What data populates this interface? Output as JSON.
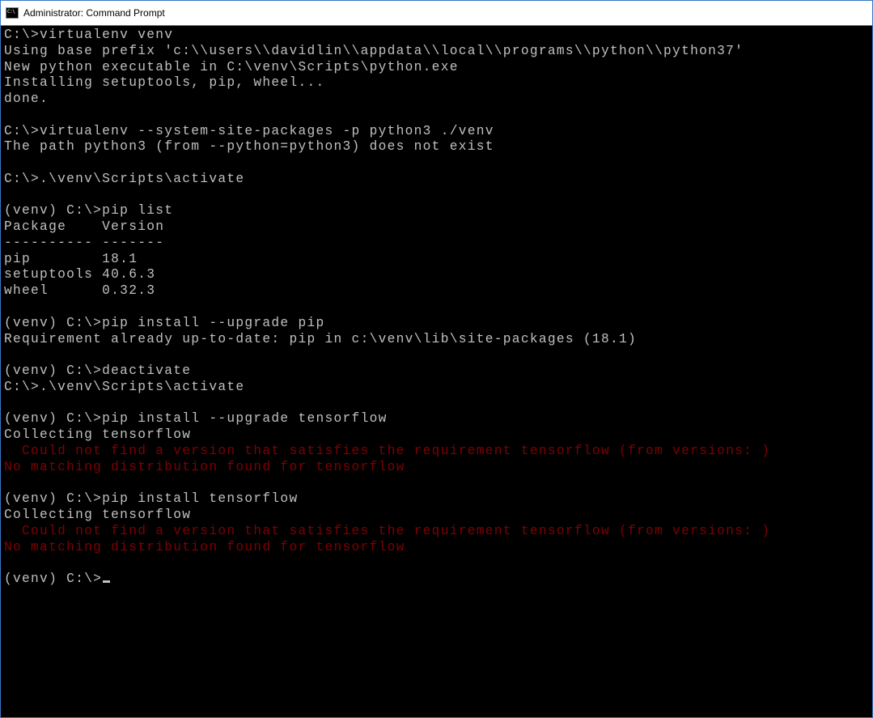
{
  "window": {
    "title": "Administrator: Command Prompt"
  },
  "lines": [
    {
      "cls": "output",
      "text": "C:\\>virtualenv venv"
    },
    {
      "cls": "output",
      "text": "Using base prefix 'c:\\\\users\\\\davidlin\\\\appdata\\\\local\\\\programs\\\\python\\\\python37'"
    },
    {
      "cls": "output",
      "text": "New python executable in C:\\venv\\Scripts\\python.exe"
    },
    {
      "cls": "output",
      "text": "Installing setuptools, pip, wheel..."
    },
    {
      "cls": "output",
      "text": "done."
    },
    {
      "cls": "output",
      "text": ""
    },
    {
      "cls": "output",
      "text": "C:\\>virtualenv --system-site-packages -p python3 ./venv"
    },
    {
      "cls": "output",
      "text": "The path python3 (from --python=python3) does not exist"
    },
    {
      "cls": "output",
      "text": ""
    },
    {
      "cls": "output",
      "text": "C:\\>.\\venv\\Scripts\\activate"
    },
    {
      "cls": "output",
      "text": ""
    },
    {
      "cls": "output",
      "text": "(venv) C:\\>pip list"
    },
    {
      "cls": "output",
      "text": "Package    Version"
    },
    {
      "cls": "output",
      "text": "---------- -------"
    },
    {
      "cls": "output",
      "text": "pip        18.1"
    },
    {
      "cls": "output",
      "text": "setuptools 40.6.3"
    },
    {
      "cls": "output",
      "text": "wheel      0.32.3"
    },
    {
      "cls": "output",
      "text": ""
    },
    {
      "cls": "output",
      "text": "(venv) C:\\>pip install --upgrade pip"
    },
    {
      "cls": "output",
      "text": "Requirement already up-to-date: pip in c:\\venv\\lib\\site-packages (18.1)"
    },
    {
      "cls": "output",
      "text": ""
    },
    {
      "cls": "output",
      "text": "(venv) C:\\>deactivate"
    },
    {
      "cls": "output",
      "text": "C:\\>.\\venv\\Scripts\\activate"
    },
    {
      "cls": "output",
      "text": ""
    },
    {
      "cls": "output",
      "text": "(venv) C:\\>pip install --upgrade tensorflow"
    },
    {
      "cls": "output",
      "text": "Collecting tensorflow"
    },
    {
      "cls": "error",
      "text": "  Could not find a version that satisfies the requirement tensorflow (from versions: )"
    },
    {
      "cls": "error",
      "text": "No matching distribution found for tensorflow"
    },
    {
      "cls": "output",
      "text": ""
    },
    {
      "cls": "output",
      "text": "(venv) C:\\>pip install tensorflow"
    },
    {
      "cls": "output",
      "text": "Collecting tensorflow"
    },
    {
      "cls": "error",
      "text": "  Could not find a version that satisfies the requirement tensorflow (from versions: )"
    },
    {
      "cls": "error",
      "text": "No matching distribution found for tensorflow"
    },
    {
      "cls": "output",
      "text": ""
    }
  ],
  "prompt": "(venv) C:\\>"
}
